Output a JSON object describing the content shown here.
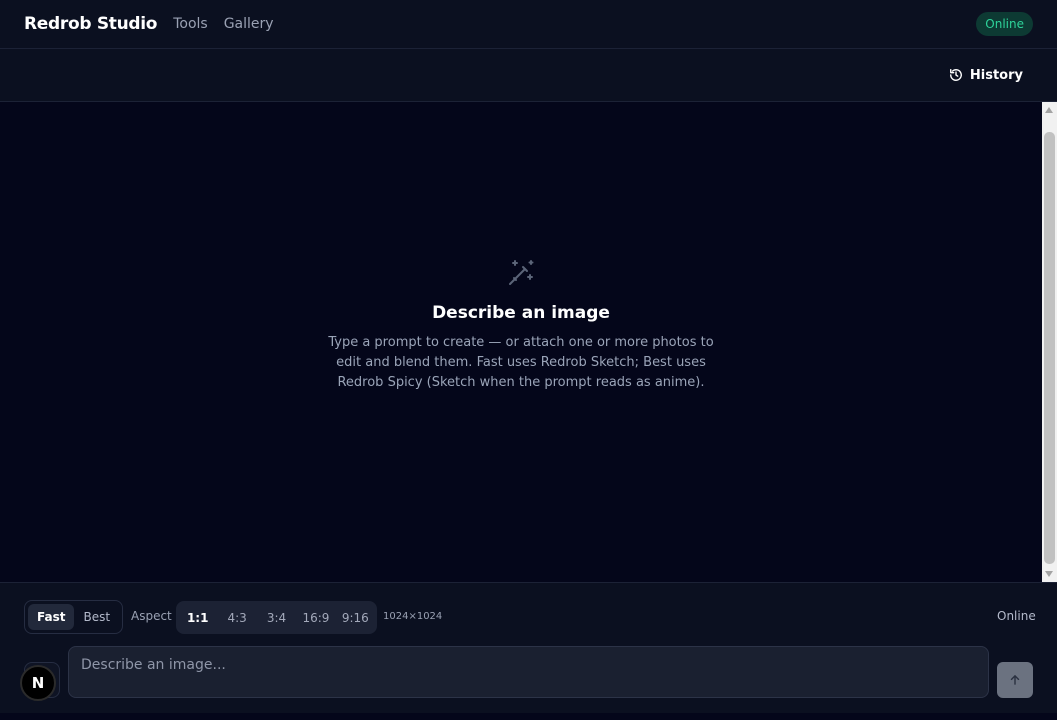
{
  "header": {
    "brand": "Redrob Studio",
    "nav": [
      {
        "label": "Tools"
      },
      {
        "label": "Gallery"
      }
    ],
    "status": "Online"
  },
  "subbar": {
    "history_label": "History",
    "history_icon": "history-icon"
  },
  "empty_state": {
    "icon": "magic-wand-icon",
    "title": "Describe an image",
    "description": "Type a prompt to create — or attach one or more photos to edit and blend them. Fast uses Redrob Sketch; Best uses Redrob Spicy (Sketch when the prompt reads as anime)."
  },
  "composer": {
    "modes": [
      {
        "label": "Fast",
        "active": true
      },
      {
        "label": "Best",
        "active": false
      }
    ],
    "aspect_label": "Aspect",
    "aspects": [
      {
        "label": "1:1",
        "active": true
      },
      {
        "label": "4:3",
        "active": false
      },
      {
        "label": "3:4",
        "active": false
      },
      {
        "label": "16:9",
        "active": false
      },
      {
        "label": "9:16",
        "active": false
      }
    ],
    "dimensions": "1024×1024",
    "status": "Online",
    "input_placeholder": "Describe an image...",
    "input_value": "",
    "avatar_letter": "N",
    "send_icon": "arrow-up-icon"
  },
  "colors": {
    "background": "#04061a",
    "panel": "#0b1020",
    "accent_online": "#2ed39a"
  }
}
